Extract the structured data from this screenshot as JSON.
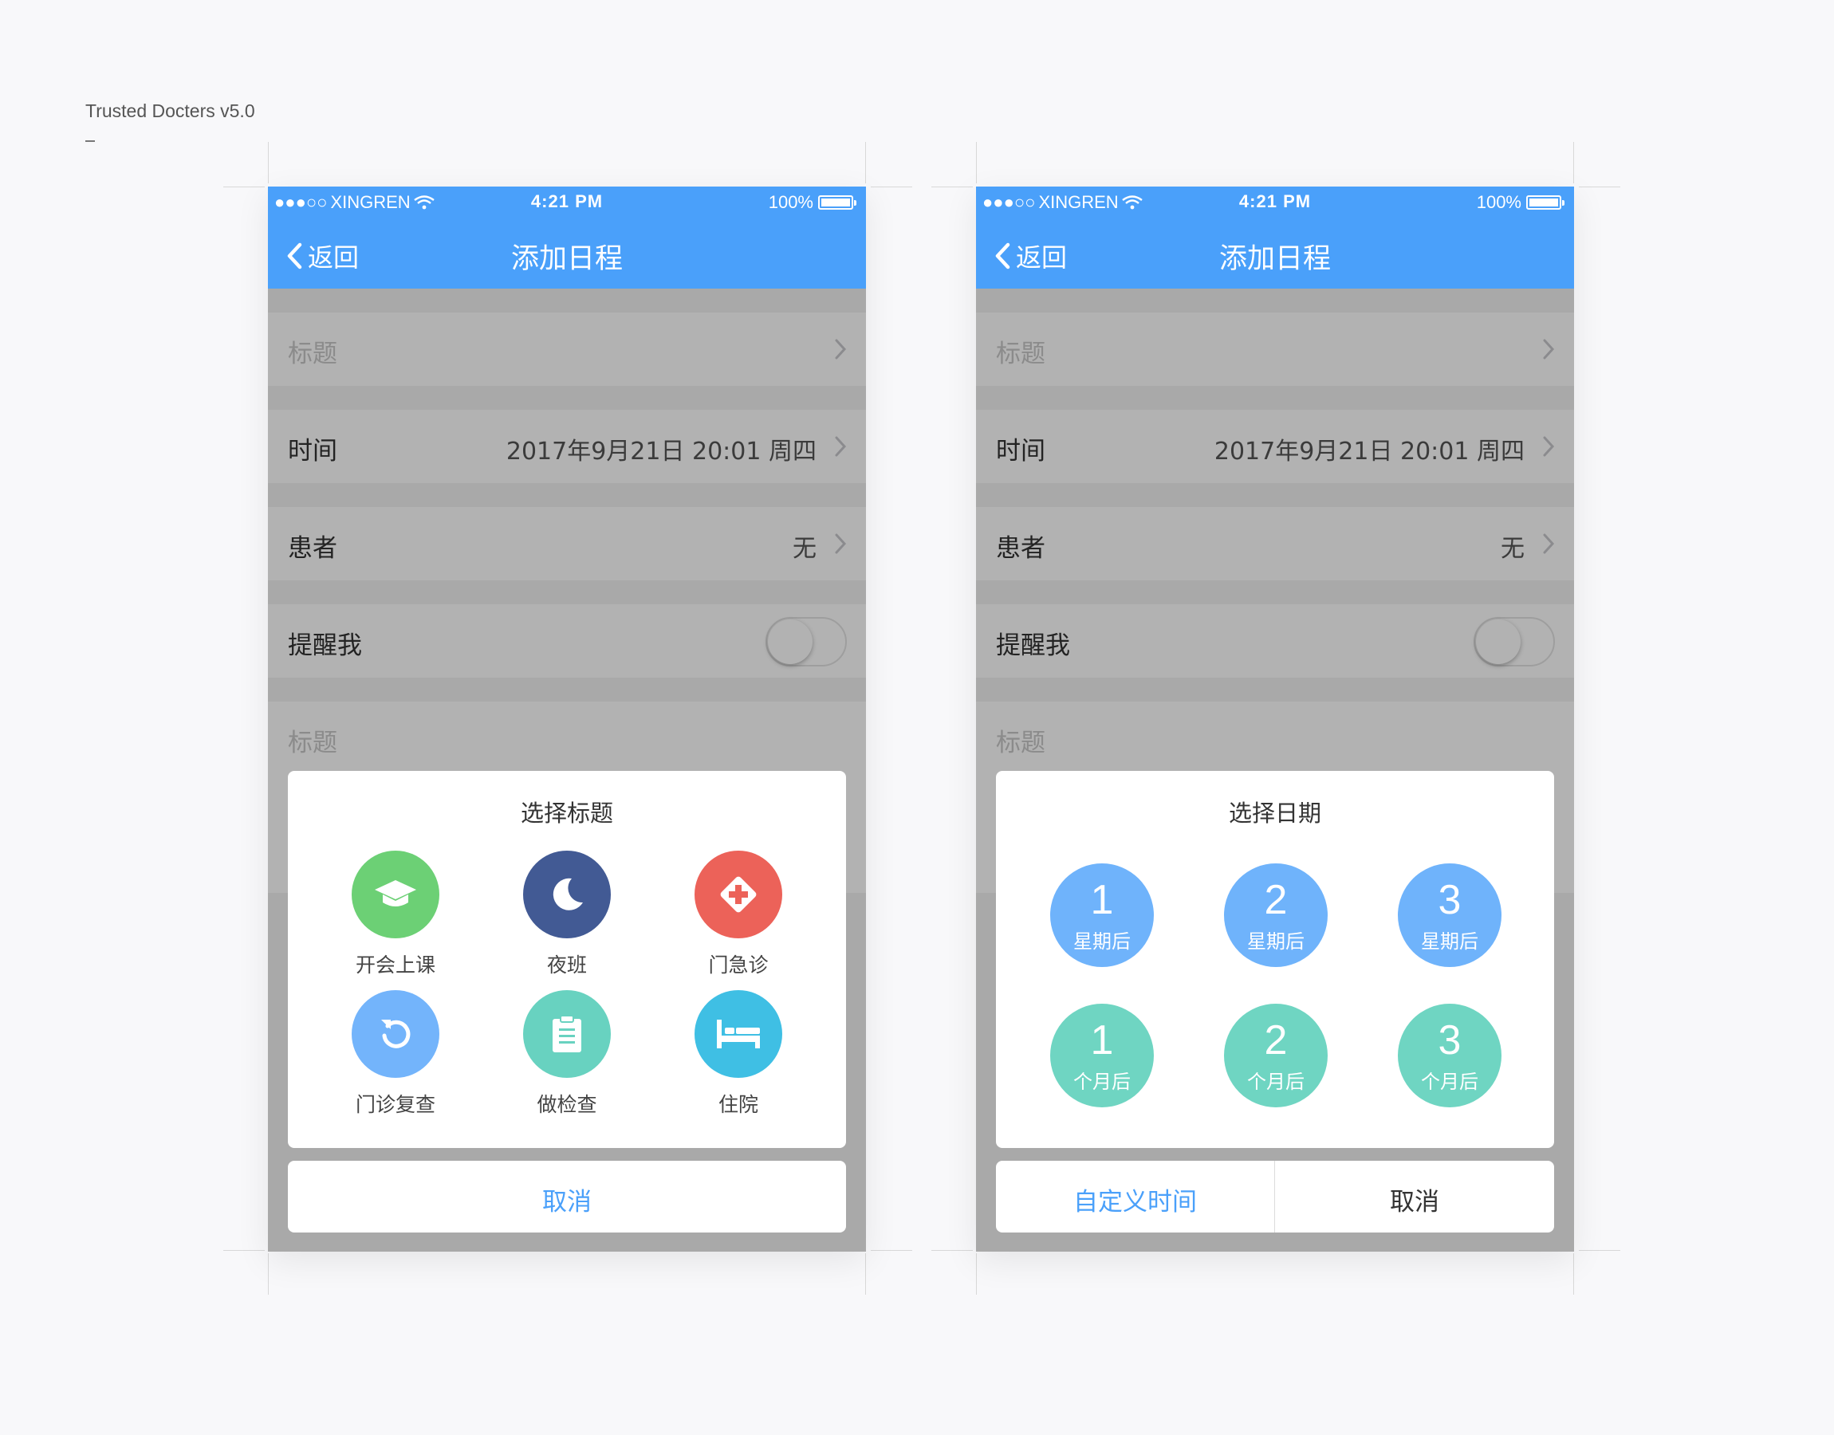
{
  "caption": "Trusted Docters v5.0",
  "colors": {
    "primary": "#4aa0fa",
    "green": "#6cd075",
    "navy": "#425a94",
    "red": "#ec6259",
    "light_blue": "#73b4fb",
    "teal": "#68d2c0",
    "cyan": "#3fbfe4",
    "week_blue": "#6fb3fb",
    "month_teal": "#6fd5c2"
  },
  "statusbar": {
    "carrier": "XINGREN",
    "time": "4:21 PM",
    "battery": "100%"
  },
  "navbar": {
    "back_label": "返回",
    "title": "添加日程"
  },
  "form": {
    "title_placeholder": "标题",
    "time_label": "时间",
    "time_value": "2017年9月21日  20:01  周四",
    "patient_label": "患者",
    "patient_value": "无",
    "remind_label": "提醒我",
    "remind_on": false,
    "title2_placeholder": "标题"
  },
  "sheet1": {
    "title": "选择标题",
    "options": [
      {
        "label": "开会上课",
        "icon": "graduation-cap-icon",
        "color": "#6cd075"
      },
      {
        "label": "夜班",
        "icon": "moon-icon",
        "color": "#425a94"
      },
      {
        "label": "门急诊",
        "icon": "medical-cross-icon",
        "color": "#ec6259"
      },
      {
        "label": "门诊复查",
        "icon": "refresh-icon",
        "color": "#73b4fb"
      },
      {
        "label": "做检查",
        "icon": "clipboard-icon",
        "color": "#68d2c0"
      },
      {
        "label": "住院",
        "icon": "bed-icon",
        "color": "#3fbfe4"
      }
    ],
    "cancel": "取消"
  },
  "sheet2": {
    "title": "选择日期",
    "weeks": [
      {
        "num": "1",
        "unit": "星期后"
      },
      {
        "num": "2",
        "unit": "星期后"
      },
      {
        "num": "3",
        "unit": "星期后"
      }
    ],
    "months": [
      {
        "num": "1",
        "unit": "个月后"
      },
      {
        "num": "2",
        "unit": "个月后"
      },
      {
        "num": "3",
        "unit": "个月后"
      }
    ],
    "custom": "自定义时间",
    "cancel": "取消"
  }
}
